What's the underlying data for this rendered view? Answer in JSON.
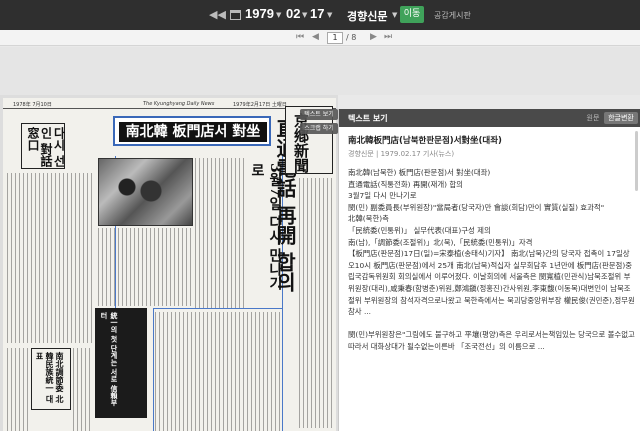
{
  "topbar": {
    "prev_year": "◀◀",
    "prev_day": "◀",
    "year": "1979",
    "month": "02",
    "day": "17",
    "next_day": "▶",
    "next_year": "▶▶",
    "newspaper": "경향신문",
    "go_button": "이동",
    "board_link": "공감게시판"
  },
  "pagebar": {
    "first": "⏮",
    "prev": "◀",
    "current_page": "1",
    "total": "/ 8",
    "next": "▶",
    "last": "⏭"
  },
  "viewer": {
    "tool_text_view": "텍스트 보기",
    "tool_scrap": "스크랩 하기",
    "headline_box": "南北韓 板門店서 對坐",
    "headline_vertical": "直通電話 再開 합의",
    "headline_vertical2": "3월7일 다시 만나기로",
    "masthead": "京鄕新聞",
    "left_box": "다시 선 인 對話窓口",
    "black_column": "統一의 첫 단계는 서로 信賴부터",
    "sub_caption": "南北調節委 北韓民族統一 대표"
  },
  "text_panel": {
    "tab_title": "텍스트 보기",
    "toggle_original": "원문",
    "toggle_hangul": "한글변환",
    "article_title": "南北韓板門店(남북한판문점)서對坐(대좌)",
    "meta": "경향신문 | 1979.02.17 기사(뉴스)",
    "paragraphs": [
      "南北韓(남북한) 板門店(판문점)서 對坐(대좌)",
      "直通電話(직통전화) 再開(재개) 합의",
      "3월7일 다시 만나기로",
      "閔(민) 副委員長(부위원장)\"當局者(당국자)만 會談(회담)만이 實質(실질) 효과적\"",
      "北韓(북한)측",
      "「民統委(민통위)」 실무代表(대표)구성 제의",
      "南(남),「調節委(조절위)」北(북),「民統委(민통위)」자격",
      "【板門店(판문점)17日(일)=宋泰植(송태식)기자】 南北(남북)간의 당국자 접촉이 17일상오10시 板門店(판문점)에서 25개 南北(남북)적십자 실무회담후 1년만에 板門店(판문점)중립국감독위원회 회의실에서 이루어졌다. 이날회의에 서울측은 閔寬植(민관식)남북조절위 부위원장(대리),咸秉春(함병춘)위원,鄭鴻鎭(정홍진)간사위원,李東馥(이동복)대변인이 남북조절위 부위원장의 참석자격으로나왔고 북한측에서는 북괴당중앙위부장 權民俊(권민준),정무원참사 ..."
    ],
    "paragraph2": "閔(민)부위원장은\"그림에도 불구하고 平壤(평양)측은 우리로서는책임있는 당국으로 볼수없고따라서 대화상대가 될수없는이른바 「조국전선」의 이름으로 ..."
  }
}
